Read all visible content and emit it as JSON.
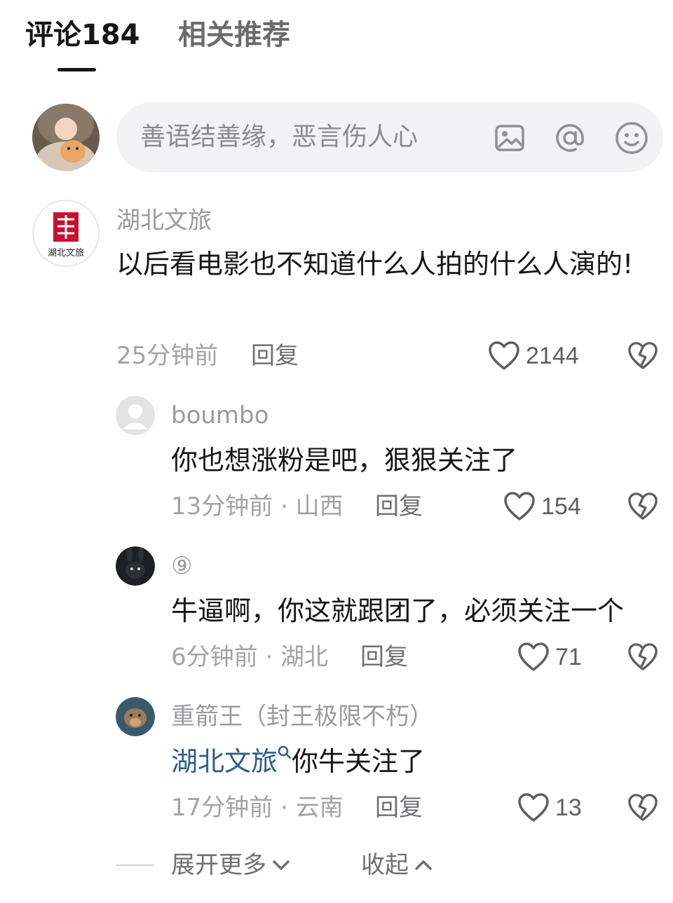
{
  "tabs": [
    {
      "label": "评论184",
      "active": true
    },
    {
      "label": "相关推荐",
      "active": false
    }
  ],
  "compose": {
    "placeholder": "善语结善缘，恶言伤人心",
    "icons": [
      "image-icon",
      "at-icon",
      "emoji-icon"
    ]
  },
  "comments": [
    {
      "author": "湖北文旅",
      "avatar_logo_text": "湖北文旅",
      "content": "以后看电影也不知道什么人拍的什么人演的!",
      "time": "25分钟前",
      "reply_label": "回复",
      "likes": "2144"
    }
  ],
  "replies": [
    {
      "author": "boumbo",
      "content": "你也想涨粉是吧，狠狠关注了",
      "time": "13分钟前 · 山西",
      "reply_label": "回复",
      "likes": "154"
    },
    {
      "author": "⑨",
      "content": "牛逼啊，你这就跟团了，必须关注一个",
      "time": "6分钟前 · 湖北",
      "reply_label": "回复",
      "likes": "71"
    },
    {
      "author": "重箭王（封王极限不朽）",
      "mention": "湖北文旅",
      "content": "你牛关注了",
      "time": "17分钟前 · 云南",
      "reply_label": "回复",
      "likes": "13"
    }
  ],
  "footer": {
    "expand_label": "展开更多",
    "collapse_label": "收起"
  },
  "colors": {
    "mention": "#2f5d8a",
    "logo_red": "#c8102e"
  }
}
